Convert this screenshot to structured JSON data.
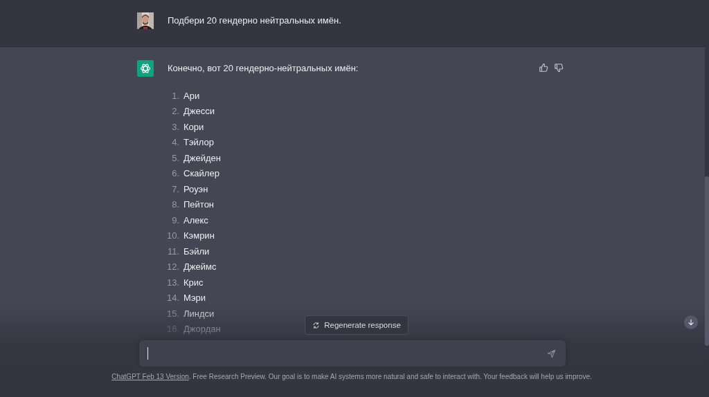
{
  "user_message": {
    "text": "Подбери 20 гендерно нейтральных имён."
  },
  "assistant_message": {
    "intro": "Конечно, вот 20 гендерно-нейтральных имён:",
    "items": [
      {
        "number": "1.",
        "name": "Ари"
      },
      {
        "number": "2.",
        "name": "Джесси"
      },
      {
        "number": "3.",
        "name": "Кори"
      },
      {
        "number": "4.",
        "name": "Тэйлор"
      },
      {
        "number": "5.",
        "name": "Джейден"
      },
      {
        "number": "6.",
        "name": "Скайлер"
      },
      {
        "number": "7.",
        "name": "Роуэн"
      },
      {
        "number": "8.",
        "name": "Пейтон"
      },
      {
        "number": "9.",
        "name": "Алекс"
      },
      {
        "number": "10.",
        "name": "Кэмрин"
      },
      {
        "number": "11.",
        "name": "Бэйли"
      },
      {
        "number": "12.",
        "name": "Джеймс"
      },
      {
        "number": "13.",
        "name": "Крис"
      },
      {
        "number": "14.",
        "name": "Мэри"
      },
      {
        "number": "15.",
        "name": "Линдси"
      },
      {
        "number": "16.",
        "name": "Джордан"
      }
    ]
  },
  "regenerate_button": {
    "label": "Regenerate response"
  },
  "footer": {
    "link": "ChatGPT Feb 13 Version",
    "text": ". Free Research Preview. Our goal is to make AI systems more natural and safe to interact with. Your feedback will help us improve."
  }
}
